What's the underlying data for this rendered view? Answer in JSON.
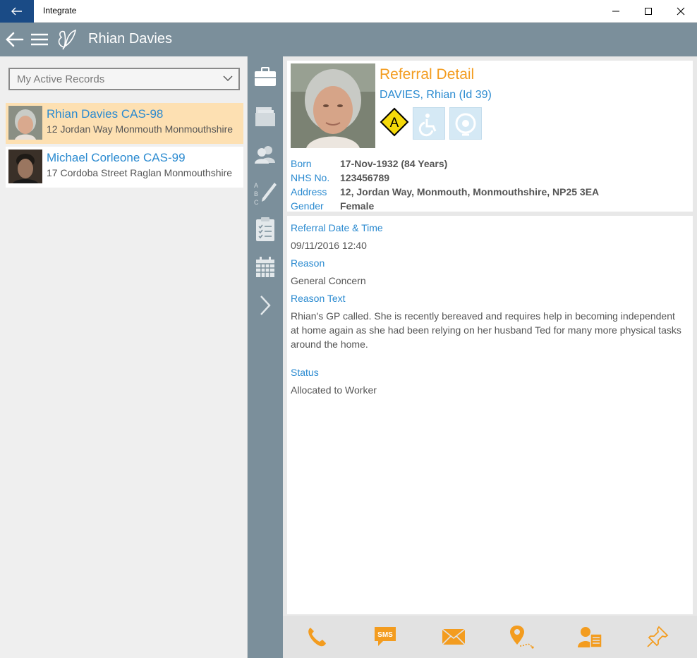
{
  "window": {
    "title": "Integrate"
  },
  "header": {
    "title": "Rhian Davies"
  },
  "list": {
    "filter_value": "My Active Records",
    "records": [
      {
        "name": "Rhian Davies CAS-98",
        "address": "12 Jordan Way Monmouth Monmouthshire"
      },
      {
        "name": "Michael Corleone CAS-99",
        "address": "17 Cordoba Street Raglan Monmouthshire"
      }
    ]
  },
  "detail": {
    "title": "Referral Detail",
    "subtitle": "DAVIES, Rhian (Id 39)",
    "alert_badge": "A",
    "born_label": "Born",
    "born_value": "17-Nov-1932 (84 Years)",
    "nhs_label": "NHS No.",
    "nhs_value": "123456789",
    "address_label": "Address",
    "address_value": "12, Jordan Way, Monmouth, Monmouthshire, NP25 3EA",
    "gender_label": "Gender",
    "gender_value": "Female",
    "referral_date_label": "Referral Date & Time",
    "referral_date_value": "09/11/2016 12:40",
    "reason_label": "Reason",
    "reason_value": "General Concern",
    "reason_text_label": "Reason Text",
    "reason_text_value": "Rhian's GP called. She is recently bereaved and requires help in becoming independent at home again as she had been relying on her husband Ted for many more physical tasks around the home.",
    "status_label": "Status",
    "status_value": "Allocated to Worker"
  },
  "actions": {
    "sms_label": "SMS"
  },
  "colors": {
    "accent": "#f39c1f",
    "link": "#2a8ad0",
    "header_bg": "#7b8f9b",
    "titlebar_back": "#1a4b86",
    "selected_row": "#fde0b2"
  }
}
